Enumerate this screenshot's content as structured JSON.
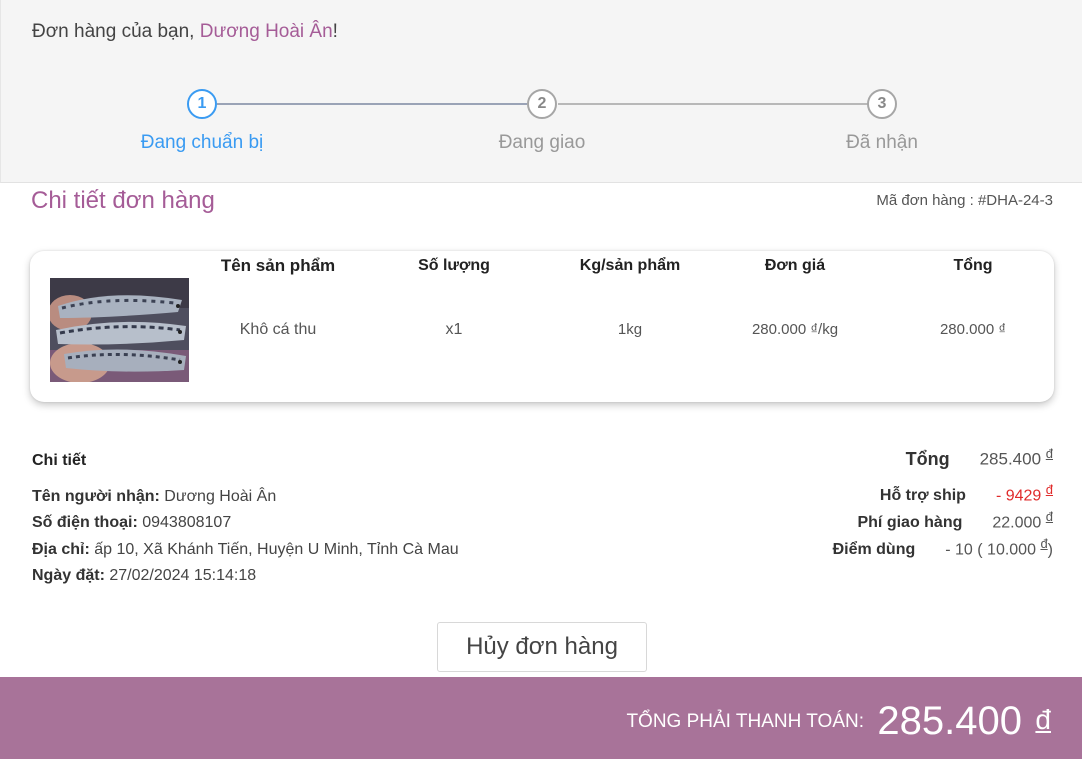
{
  "header": {
    "greeting_prefix": "Đơn hàng của bạn, ",
    "customer_name": "Dương Hoài Ân",
    "greeting_suffix": "!"
  },
  "steps": [
    {
      "number": "1",
      "label": "Đang chuẩn bị",
      "active": true
    },
    {
      "number": "2",
      "label": "Đang giao",
      "active": false
    },
    {
      "number": "3",
      "label": "Đã nhận",
      "active": false
    }
  ],
  "order": {
    "section_title": "Chi tiết đơn hàng",
    "order_id": "Mã đơn hàng : #DHA-24-3"
  },
  "table": {
    "headers": [
      "Tên sản phẩm",
      "Số lượng",
      "Kg/sản phẩm",
      "Đơn giá",
      "Tổng"
    ],
    "rows": [
      {
        "image": "dried-mackerel-photo",
        "name": "Khô cá thu",
        "quantity": "x1",
        "kg": "1kg",
        "unit_price": "280.000 ₫/kg",
        "total": "280.000 ₫"
      }
    ]
  },
  "details": {
    "heading": "Chi tiết",
    "recipient_label": "Tên người nhận:",
    "recipient": "Dương Hoài Ân",
    "phone_label": "Số điện thoại:",
    "phone": "0943808107",
    "address_label": "Địa chỉ:",
    "address": "ấp 10, Xã Khánh Tiến, Huyện U Minh, Tỉnh Cà Mau",
    "date_label": "Ngày đặt:",
    "date": "27/02/2024 15:14:18"
  },
  "summary": {
    "total_label": "Tổng",
    "total_value": "285.400",
    "ship_support_label": "Hỗ trợ ship",
    "ship_support_value": "- 9429",
    "shipping_fee_label": "Phí giao hàng",
    "shipping_fee_value": "22.000",
    "points_label": "Điểm dùng",
    "points_value": "- 10 ( 10.000",
    "points_close": ")",
    "currency": "đ"
  },
  "actions": {
    "cancel_label": "Hủy đơn hàng"
  },
  "footer": {
    "label": "TỔNG PHẢI THANH TOÁN:",
    "amount": "285.400",
    "currency": "đ"
  },
  "colors": {
    "accent": "#a55c97",
    "active_step": "#3a9bf2",
    "footer_bg": "#a87399",
    "negative": "#e02b2b"
  }
}
